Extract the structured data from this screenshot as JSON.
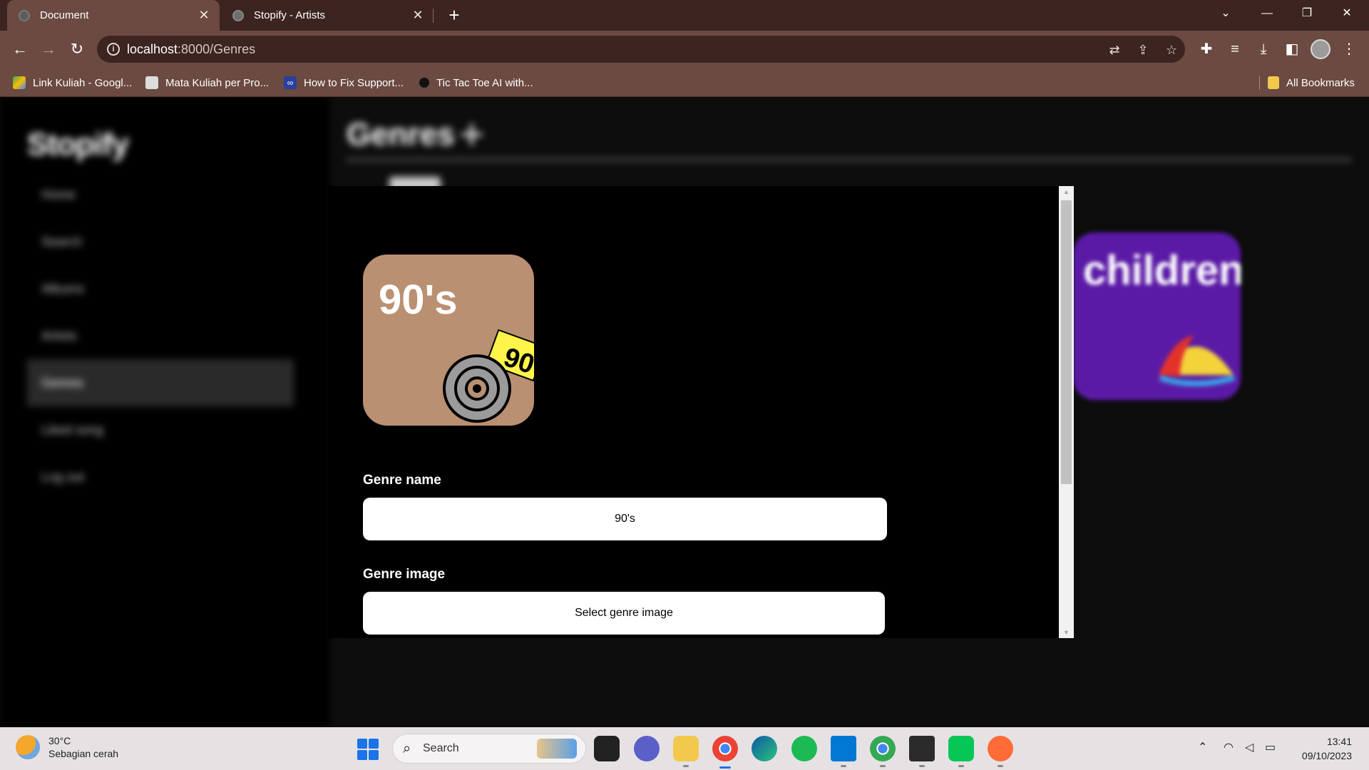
{
  "browser": {
    "tabs": [
      {
        "title": "Document",
        "active": true
      },
      {
        "title": "Stopify - Artists",
        "active": false
      }
    ],
    "new_tab_symbol": "+",
    "address": {
      "host": "localhost",
      "path": ":8000/Genres"
    },
    "bookmarks": [
      {
        "label": "Link Kuliah - Googl...",
        "icon": "google-drive-icon"
      },
      {
        "label": "Mata Kuliah per Pro...",
        "icon": "bookmark-page-icon"
      },
      {
        "label": "How to Fix Support...",
        "icon": "infinity-icon"
      },
      {
        "label": "Tic Tac Toe AI with...",
        "icon": "circle-icon"
      }
    ],
    "all_bookmarks_label": "All Bookmarks"
  },
  "app": {
    "brand": "Stopify",
    "nav": [
      {
        "label": "Home"
      },
      {
        "label": "Search"
      },
      {
        "label": "Albums"
      },
      {
        "label": "Artists"
      },
      {
        "label": "Genres",
        "active": true
      },
      {
        "label": "Liked song"
      },
      {
        "label": "Log out"
      }
    ],
    "page_title": "Genres",
    "add_symbol": "+",
    "background_card": {
      "title": "children"
    }
  },
  "modal": {
    "cover": {
      "title": "90's",
      "tag": "90"
    },
    "genre_name_label": "Genre name",
    "genre_name_value": "90's",
    "genre_image_label": "Genre image",
    "genre_image_button": "Select genre image"
  },
  "taskbar": {
    "weather": {
      "temp": "30°C",
      "condition": "Sebagian cerah"
    },
    "search_placeholder": "Search",
    "time": "13:41",
    "date": "09/10/2023"
  },
  "colors": {
    "chrome_dark": "#3c2420",
    "chrome_light": "#6b4a41",
    "cover_bg": "#ba9072",
    "card_bg": "#5b1aa6"
  }
}
